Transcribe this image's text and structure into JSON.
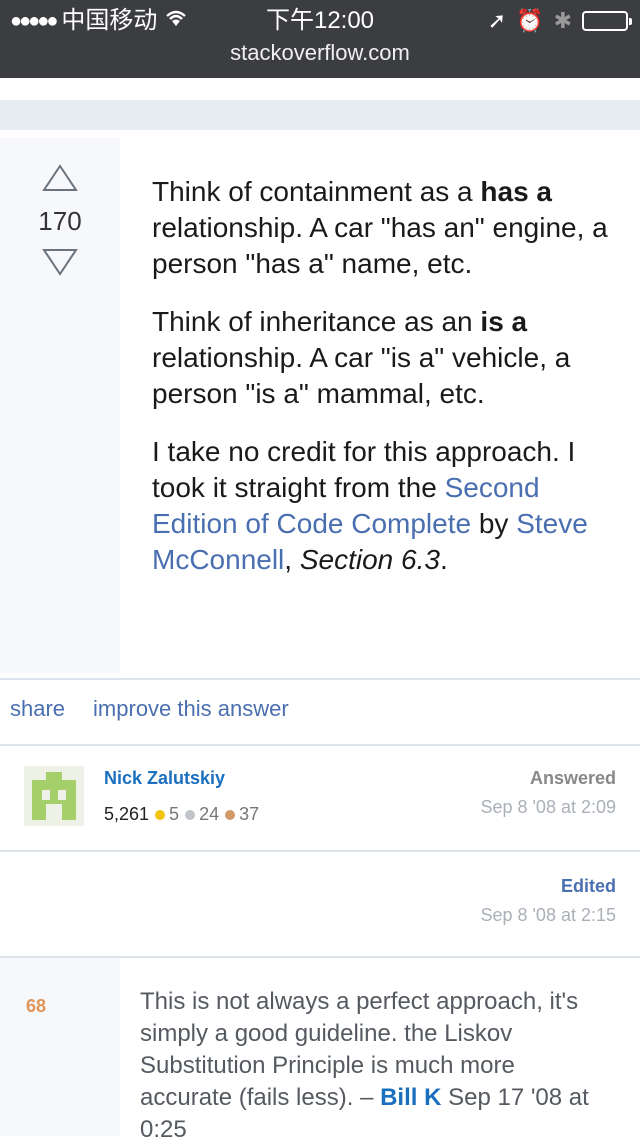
{
  "status_bar": {
    "signal_dots": "●●●●●",
    "carrier": "中国移动",
    "wifi_icon": "wifi-icon",
    "time": "下午12:00",
    "location_icon": "➚",
    "alarm_icon": "⏰",
    "bluetooth_icon": "✱"
  },
  "browser": {
    "url": "stackoverflow.com"
  },
  "answer": {
    "vote_count": "170",
    "p1_a": "Think of containment as a ",
    "p1_bold": "has a",
    "p1_b": " relationship. A car \"has an\" engine, a person \"has a\" name, etc.",
    "p2_a": "Think of inheritance as an ",
    "p2_bold": "is a",
    "p2_b": " relationship. A car \"is a\" vehicle, a person \"is a\" mammal, etc.",
    "p3_a": "I take no credit for this approach. I took it straight from the ",
    "p3_link1": "Second Edition of Code Complete",
    "p3_b": " by ",
    "p3_link2": "Steve McConnell",
    "p3_c": ", ",
    "p3_italic": "Section 6.3",
    "p3_d": "."
  },
  "actions": {
    "share": "share",
    "improve": "improve this answer"
  },
  "author": {
    "name": "Nick Zalutskiy",
    "reputation": "5,261",
    "gold": "5",
    "silver": "24",
    "bronze": "37",
    "answered_label": "Answered",
    "answered_date": "Sep 8 '08 at 2:09",
    "edited_label": "Edited",
    "edited_date": "Sep 8 '08 at 2:15"
  },
  "badge_colors": {
    "gold": "#f1c40f",
    "silver": "#c0c4c8",
    "bronze": "#d29a6a"
  },
  "comment": {
    "score": "68",
    "text": "This is not always a perfect approach, it's simply a good guideline. the Liskov Substitution Principle is much more accurate (fails less). – ",
    "user": "Bill K",
    "date": " Sep 17 '08 at 0:25"
  }
}
